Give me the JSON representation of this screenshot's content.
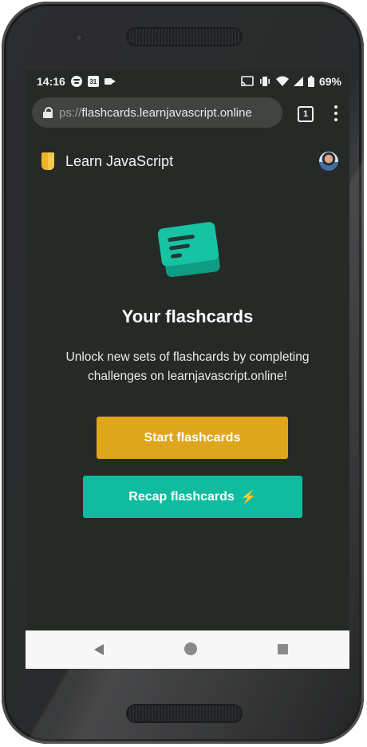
{
  "status_bar": {
    "time": "14:16",
    "calendar_day": "31",
    "battery": "69%",
    "icons": [
      "spotify-icon",
      "calendar-icon",
      "video-icon",
      "cast-icon",
      "vibrate-icon",
      "wifi-icon",
      "signal-icon",
      "battery-icon"
    ]
  },
  "browser": {
    "url_prefix": "ps://",
    "url_main": "flashcards.learnjavascript.online",
    "tab_count": "1"
  },
  "app": {
    "title": "Learn JavaScript"
  },
  "main": {
    "heading": "Your flashcards",
    "description": "Unlock new sets of flashcards by completing challenges on learnjavascript.online!",
    "start_button": "Start flashcards",
    "recap_button": "Recap flashcards",
    "recap_icon": "⚡"
  },
  "colors": {
    "background": "#262a26",
    "start_button": "#dfa51d",
    "recap_button": "#0fbca0",
    "icon_teal": "#16c3a2"
  }
}
